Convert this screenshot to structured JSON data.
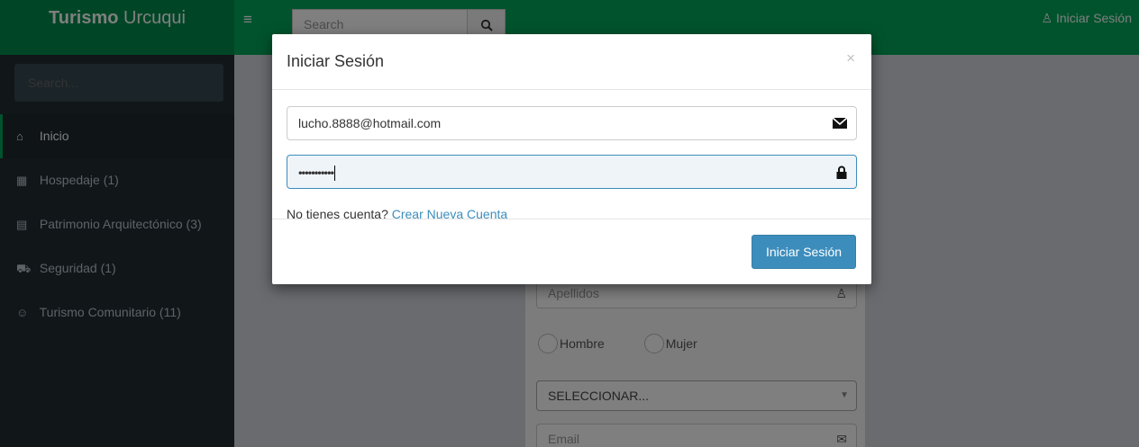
{
  "header": {
    "logo_bold": "Turismo",
    "logo_rest": "Urcuqui",
    "menu_icon": "hamburger-icon",
    "search_placeholder": "Search",
    "search_icon": "search-icon",
    "login_label": "Iniciar Sesión",
    "login_icon": "user-icon",
    "color": "#00a65a"
  },
  "sidebar": {
    "search_placeholder": "Search...",
    "items": [
      {
        "label": "Inicio",
        "icon": "home-icon",
        "glyph": "🏠"
      },
      {
        "label": "Hospedaje (1)",
        "icon": "building-icon",
        "glyph": "▦"
      },
      {
        "label": "Patrimonio Arquitectónico (3)",
        "icon": "bank-icon",
        "glyph": "🏛"
      },
      {
        "label": "Seguridad (1)",
        "icon": "truck-icon",
        "glyph": "⛟"
      },
      {
        "label": "Turismo Comunitario (11)",
        "icon": "smile-icon",
        "glyph": "☺"
      }
    ]
  },
  "background_form": {
    "apellidos_placeholder": "Apellidos",
    "gender_male": "Hombre",
    "gender_female": "Mujer",
    "select_value": "SELECCIONAR...",
    "email_placeholder": "Email"
  },
  "modal": {
    "title": "Iniciar Sesión",
    "close": "×",
    "email_value": "lucho.8888@hotmail.com",
    "email_icon": "envelope-icon",
    "password_value": "•••••••••••",
    "password_icon": "lock-icon",
    "no_account_text": "No tienes cuenta?",
    "create_account_link": "Crear Nueva Cuenta",
    "submit_label": "Iniciar Sesión",
    "button_color": "#3c8dbc"
  }
}
